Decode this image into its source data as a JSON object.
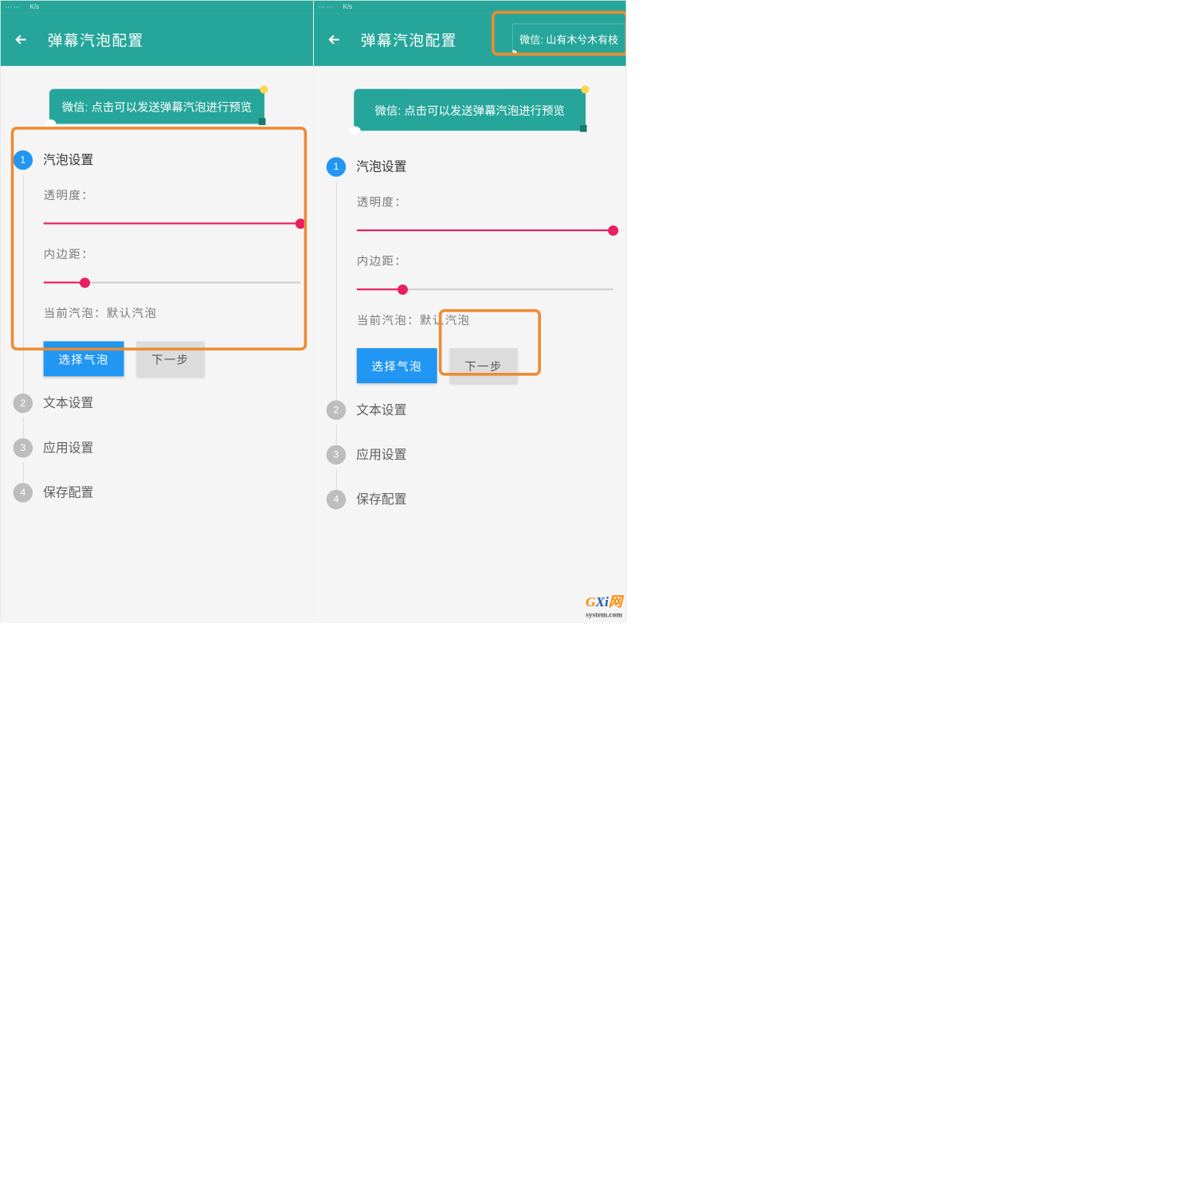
{
  "status_bar": {
    "dots": "⋯   ⋯",
    "speed": "K/s"
  },
  "app_bar": {
    "title": "弹幕汽泡配置"
  },
  "notification": {
    "text": "微信: 山有木兮木有枝"
  },
  "bubble_preview": {
    "text": "微信: 点击可以发送弹幕汽泡进行预览"
  },
  "stepper": {
    "steps": [
      {
        "num": "1",
        "title": "汽泡设置",
        "active": true
      },
      {
        "num": "2",
        "title": "文本设置",
        "active": false
      },
      {
        "num": "3",
        "title": "应用设置",
        "active": false
      },
      {
        "num": "4",
        "title": "保存配置",
        "active": false
      }
    ]
  },
  "step1": {
    "opacity_label": "透明度：",
    "opacity_value": 100,
    "padding_label": "内边距：",
    "padding_value": 16,
    "current_label": "当前汽泡：",
    "current_value": "默认汽泡",
    "select_btn": "选择气泡",
    "next_btn": "下一步"
  },
  "watermark": {
    "brand_g": "G",
    "brand_xi": "Xi",
    "brand_wang": "网",
    "domain": "system.com"
  }
}
